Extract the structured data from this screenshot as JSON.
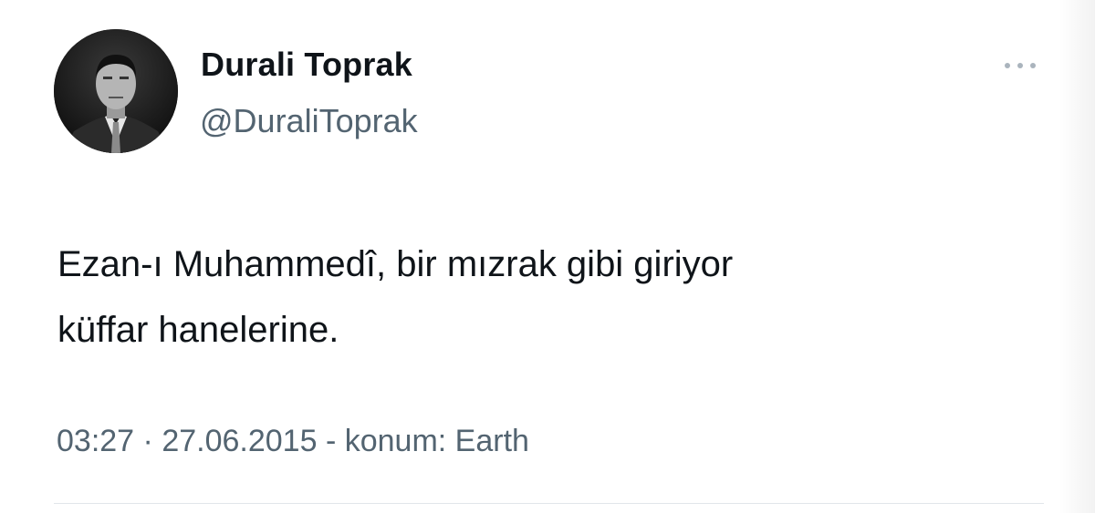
{
  "author": {
    "display_name": "Durali Toprak",
    "handle": "@DuraliToprak"
  },
  "tweet": {
    "text": "Ezan-ı Muhammedî, bir mızrak gibi giriyor\nküffar hanelerine.",
    "time": "03:27",
    "separator": "·",
    "date": "27.06.2015",
    "location": "- konum: Earth"
  },
  "icons": {
    "more": "more-horizontal-icon",
    "avatar": "profile-photo"
  },
  "colors": {
    "primary_text": "#0f1419",
    "secondary_text": "#536471",
    "divider": "#e1e6ea"
  }
}
